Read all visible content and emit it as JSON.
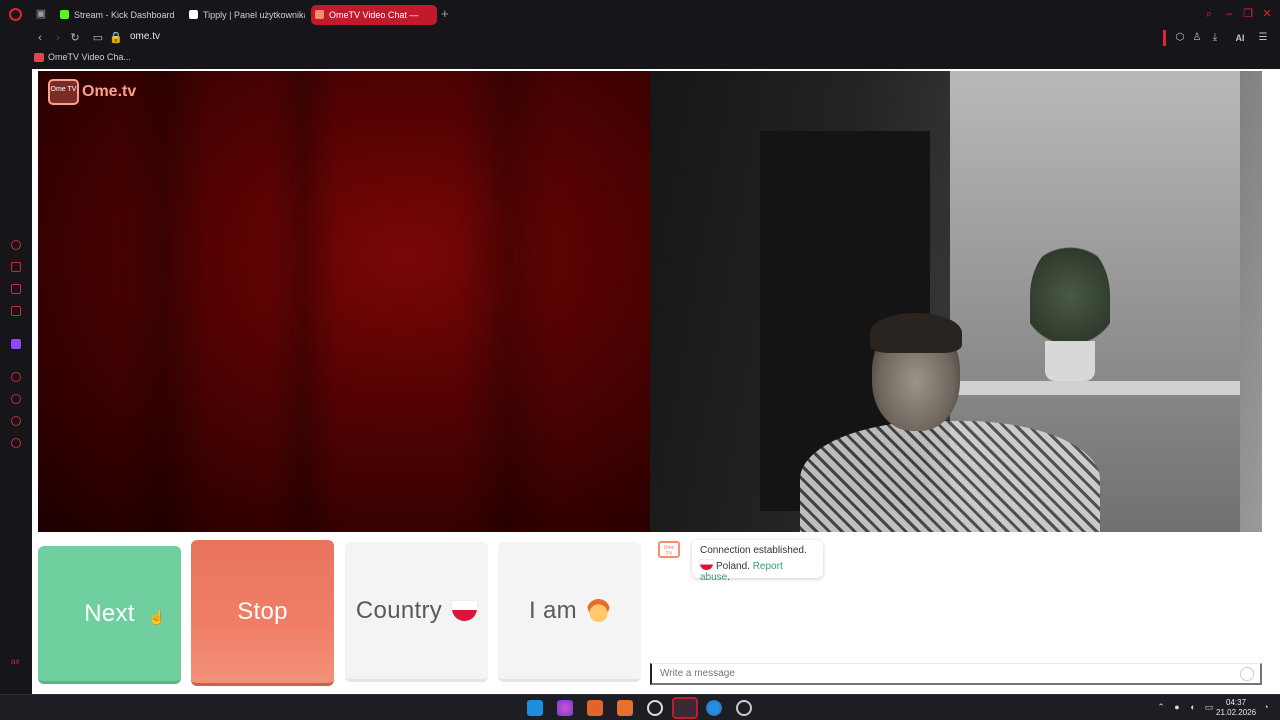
{
  "browser": {
    "tabs": [
      {
        "title": "Stream - Kick Dashboard",
        "active": false,
        "favicon_color": "#53fc18"
      },
      {
        "title": "Tipply | Panel użytkownika",
        "active": false,
        "favicon_color": "#ffffff"
      },
      {
        "title": "OmeTV Video Chat —",
        "active": true,
        "favicon_color": "#ff8a6e"
      }
    ],
    "url": "ome.tv",
    "bookmark": "OmeTV Video Cha...",
    "ai_label": "AI",
    "accent_color": "#e0243a"
  },
  "page": {
    "logo_text": "Ome.tv",
    "logo_badge": "Ome TV",
    "buttons": {
      "next": "Next",
      "stop": "Stop",
      "country": "Country",
      "iam": "I am"
    },
    "chat": {
      "logo_badge": "Ome TV",
      "message_line1": "Connection established.",
      "country": "Poland.",
      "report": "Report abuse",
      "report_suffix": ".",
      "input_placeholder": "Write a message"
    },
    "colors": {
      "next": "#6fcf9e",
      "stop": "#ee7a62",
      "neutral": "#f4f4f4"
    }
  },
  "sidebar": {
    "bottom_label": "ax"
  },
  "taskbar": {
    "time": "04:37",
    "date": "21.02.2026"
  }
}
